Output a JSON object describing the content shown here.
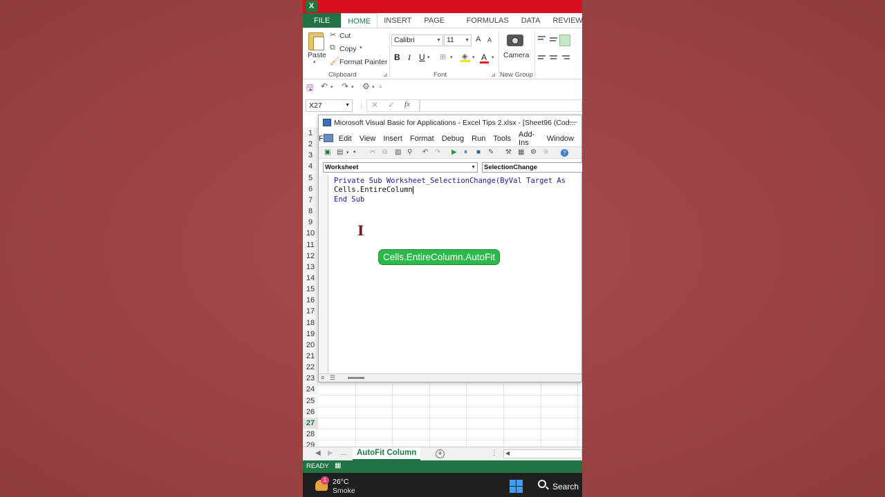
{
  "excel": {
    "app_icon": "X",
    "tabs": [
      "FILE",
      "HOME",
      "INSERT",
      "PAGE LAYOUT",
      "FORMULAS",
      "DATA",
      "REVIEW"
    ],
    "active_tab": "HOME",
    "clipboard": {
      "paste": "Paste",
      "cut": "Cut",
      "copy": "Copy",
      "format_painter": "Format Painter",
      "group": "Clipboard"
    },
    "font": {
      "name": "Calibri",
      "size": "11",
      "bold": "B",
      "italic": "I",
      "underline": "U",
      "grow": "A",
      "shrink": "A",
      "font_color": "A",
      "group": "Font"
    },
    "new_group": {
      "camera": "Camera",
      "group": "New Group"
    },
    "name_box": "X27",
    "fx": "fx",
    "rows": [
      "1",
      "2",
      "3",
      "4",
      "5",
      "6",
      "7",
      "8",
      "9",
      "10",
      "11",
      "12",
      "13",
      "14",
      "15",
      "16",
      "17",
      "18",
      "19",
      "20",
      "21",
      "22",
      "23",
      "24",
      "25",
      "26",
      "27",
      "28",
      "29"
    ],
    "selected_row": "27",
    "sheet_tab": "AutoFit Column",
    "sheet_nav_more": "...",
    "status": "READY",
    "accent": "#217346"
  },
  "vba": {
    "title": "Microsoft Visual Basic for Applications - Excel Tips 2.xlsx - [Sheet96 (Cod...",
    "menus": [
      "File",
      "Edit",
      "View",
      "Insert",
      "Format",
      "Debug",
      "Run",
      "Tools",
      "Add-Ins",
      "Window"
    ],
    "object_dropdown": "Worksheet",
    "procedure_dropdown": "SelectionChange",
    "code_lines": [
      "Private Sub Worksheet_SelectionChange(ByVal Target As",
      "Cells.EntireColumn",
      "End Sub"
    ],
    "tooltip": "Cells.EntireColumn.AutoFit"
  },
  "taskbar": {
    "weather_badge": "1",
    "temperature": "26°C",
    "condition": "Smoke",
    "search": "Search"
  }
}
